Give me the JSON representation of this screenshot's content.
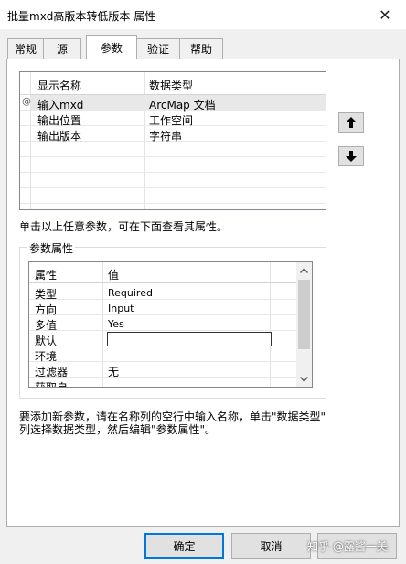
{
  "window": {
    "title": "批量mxd高版本转低版本 属性",
    "close_glyph": "✕"
  },
  "tabs": [
    {
      "label": "常规"
    },
    {
      "label": "源"
    },
    {
      "label": "参数"
    },
    {
      "label": "验证"
    },
    {
      "label": "帮助"
    }
  ],
  "params_grid": {
    "columns": [
      "显示名称",
      "数据类型"
    ],
    "row_marker": "@",
    "rows": [
      {
        "name": "输入mxd",
        "type": "ArcMap 文档"
      },
      {
        "name": "输出位置",
        "type": "工作空间"
      },
      {
        "name": "输出版本",
        "type": "字符串"
      }
    ]
  },
  "side_buttons": {
    "up_icon": "arrow-up-icon",
    "down_icon": "arrow-down-icon"
  },
  "hint_top": "单击以上任意参数，可在下面查看其属性。",
  "param_props": {
    "legend": "参数属性",
    "columns": [
      "属性",
      "值"
    ],
    "rows": [
      {
        "name": "类型",
        "value": "Required"
      },
      {
        "name": "方向",
        "value": "Input"
      },
      {
        "name": "多值",
        "value": "Yes"
      },
      {
        "name": "默认",
        "value": ""
      },
      {
        "name": "环境",
        "value": ""
      },
      {
        "name": "过滤器",
        "value": "无"
      },
      {
        "name": "获取自",
        "value": ""
      }
    ]
  },
  "hint_bottom": {
    "line1": "要添加新参数，请在名称列的空行中输入名称，单击\"数据类型\"",
    "line2": "列选择数据类型，然后编辑\"参数属性\"。"
  },
  "footer": {
    "ok_label": "确定",
    "cancel_label": "取消",
    "watermark": "知乎 @露酱一美"
  }
}
